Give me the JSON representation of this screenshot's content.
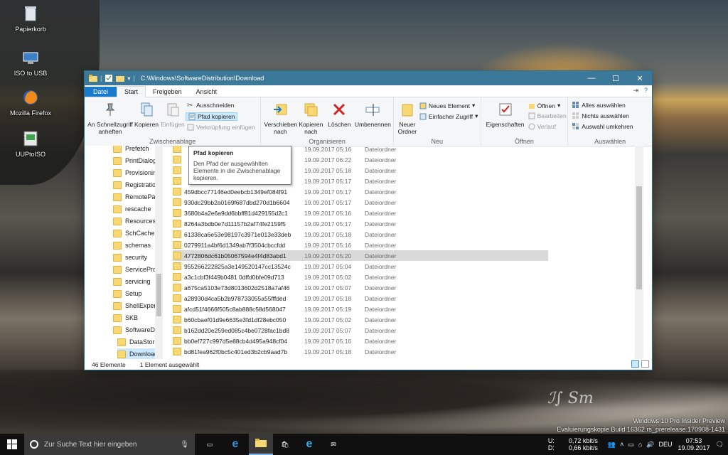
{
  "desktop": {
    "icons": [
      {
        "label": "Papierkorb"
      },
      {
        "label": "ISO to USB"
      },
      {
        "label": "Mozilla Firefox"
      },
      {
        "label": "UUPtoISO"
      }
    ],
    "watermark_line1": "Windows 10 Pro Insider Preview",
    "watermark_line2": "Evaluierungskopie Build 16362.rs_prerelease.170908-1431"
  },
  "window": {
    "path": "C:\\Windows\\SoftwareDistribution\\Download",
    "accent": "#3b7899"
  },
  "tabs": {
    "file": "Datei",
    "start": "Start",
    "share": "Freigeben",
    "view": "Ansicht"
  },
  "ribbon": {
    "clipboard": {
      "pin": "An Schnellzugriff anheften",
      "copy": "Kopieren",
      "paste": "Einfügen",
      "cut": "Ausschneiden",
      "copy_path": "Pfad kopieren",
      "paste_shortcut": "Verknüpfung einfügen",
      "label": "Zwischenablage"
    },
    "organize": {
      "move_to": "Verschieben nach",
      "copy_to": "Kopieren nach",
      "delete": "Löschen",
      "rename": "Umbenennen",
      "label": "Organisieren"
    },
    "new": {
      "new_folder": "Neuer Ordner",
      "new_item": "Neues Element",
      "easy_access": "Einfacher Zugriff",
      "label": "Neu"
    },
    "open": {
      "properties": "Eigenschaften",
      "open": "Öffnen",
      "edit": "Bearbeiten",
      "history": "Verlauf",
      "label": "Öffnen"
    },
    "select": {
      "select_all": "Alles auswählen",
      "select_none": "Nichts auswählen",
      "invert": "Auswahl umkehren",
      "label": "Auswählen"
    }
  },
  "tooltip": {
    "title": "Pfad kopieren",
    "body": "Den Pfad der ausgewählten Elemente in die Zwischenablage kopieren."
  },
  "nav": [
    {
      "label": "Prefetch"
    },
    {
      "label": "PrintDialog"
    },
    {
      "label": "Provisioning"
    },
    {
      "label": "Registration"
    },
    {
      "label": "RemotePackages"
    },
    {
      "label": "rescache"
    },
    {
      "label": "Resources"
    },
    {
      "label": "SchCache"
    },
    {
      "label": "schemas"
    },
    {
      "label": "security"
    },
    {
      "label": "ServiceProfiles"
    },
    {
      "label": "servicing"
    },
    {
      "label": "Setup"
    },
    {
      "label": "ShellExperiences"
    },
    {
      "label": "SKB"
    },
    {
      "label": "SoftwareDistribution"
    },
    {
      "label": "DataStore"
    },
    {
      "label": "Download"
    }
  ],
  "files": [
    {
      "name": "",
      "date": "19.09.2017 05:16",
      "type": "Dateiordner"
    },
    {
      "name": "",
      "date": "19.09.2017 06:22",
      "type": "Dateiordner"
    },
    {
      "name": "",
      "date": "19.09.2017 05:18",
      "type": "Dateiordner"
    },
    {
      "name": "",
      "date": "19.09.2017 05:17",
      "type": "Dateiordner"
    },
    {
      "name": "459dbcc77146ed0eebcb1349ef084f91",
      "date": "19.09.2017 05:17",
      "type": "Dateiordner"
    },
    {
      "name": "930dc29bb2a0169f687dbd270d1b6604",
      "date": "19.09.2017 05:17",
      "type": "Dateiordner"
    },
    {
      "name": "3680b4a2e6a9dd6bbff81d429155d2c1",
      "date": "19.09.2017 05:16",
      "type": "Dateiordner"
    },
    {
      "name": "8264a3bdb0e7d11157b2af74fe2159f5",
      "date": "19.09.2017 05:17",
      "type": "Dateiordner"
    },
    {
      "name": "61338ca6e53e98197c3971e013e33deb",
      "date": "19.09.2017 05:18",
      "type": "Dateiordner"
    },
    {
      "name": "0279911a4bf6d1349ab7f3504cbccfdd",
      "date": "19.09.2017 05:16",
      "type": "Dateiordner"
    },
    {
      "name": "4772806dc61b05067594e4f4d83abd1",
      "date": "19.09.2017 05:20",
      "type": "Dateiordner"
    },
    {
      "name": "955266222825a3e149520147cc13524c",
      "date": "19.09.2017 05:04",
      "type": "Dateiordner"
    },
    {
      "name": "a3c1cbf3f449b0481 0dffd0bfe09d713",
      "date": "19.09.2017 05:02",
      "type": "Dateiordner"
    },
    {
      "name": "a675ca5103e73d8013602d2518a7af46",
      "date": "19.09.2017 05:07",
      "type": "Dateiordner"
    },
    {
      "name": "a28930d4ca5b2b978733055a55fffded",
      "date": "19.09.2017 05:18",
      "type": "Dateiordner"
    },
    {
      "name": "afcd51f4666f505c8ab888c58d568047",
      "date": "19.09.2017 05:19",
      "type": "Dateiordner"
    },
    {
      "name": "b60cbaef01d9e6635e3fd1df28ebc050",
      "date": "19.09.2017 05:02",
      "type": "Dateiordner"
    },
    {
      "name": "b162dd20e259ed085c4be0728fac1bd8",
      "date": "19.09.2017 05:07",
      "type": "Dateiordner"
    },
    {
      "name": "bb0ef727c997d5e88cb4d495a948cf04",
      "date": "19.09.2017 05:16",
      "type": "Dateiordner"
    },
    {
      "name": "bd81fea962f0bc5c401ed3b2cb9aad7b",
      "date": "19.09.2017 05:18",
      "type": "Dateiordner"
    }
  ],
  "status": {
    "count": "46 Elemente",
    "selected": "1 Element ausgewählt"
  },
  "taskbar": {
    "search_placeholder": "Zur Suche Text hier eingeben",
    "upload_label": "U:",
    "download_label": "D:",
    "upload_rate": "0,72 kbit/s",
    "download_rate": "0,66 kbit/s",
    "lang": "DEU",
    "time": "07:53",
    "date": "19.09.2017"
  }
}
